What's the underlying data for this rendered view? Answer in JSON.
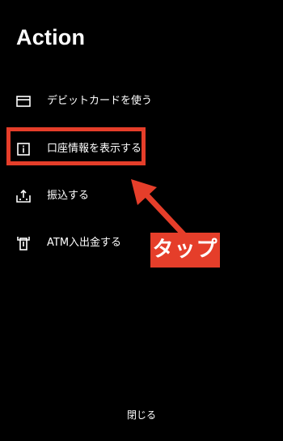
{
  "sheet": {
    "title": "Action",
    "items": [
      {
        "label": "デビットカードを使う",
        "icon": "card-icon"
      },
      {
        "label": "口座情報を表示する",
        "icon": "info-icon"
      },
      {
        "label": "振込する",
        "icon": "transfer-icon"
      },
      {
        "label": "ATM入出金する",
        "icon": "atm-icon"
      }
    ],
    "close_label": "閉じる"
  },
  "annotation": {
    "tap_label": "タップ",
    "color": "#e53e2a"
  }
}
